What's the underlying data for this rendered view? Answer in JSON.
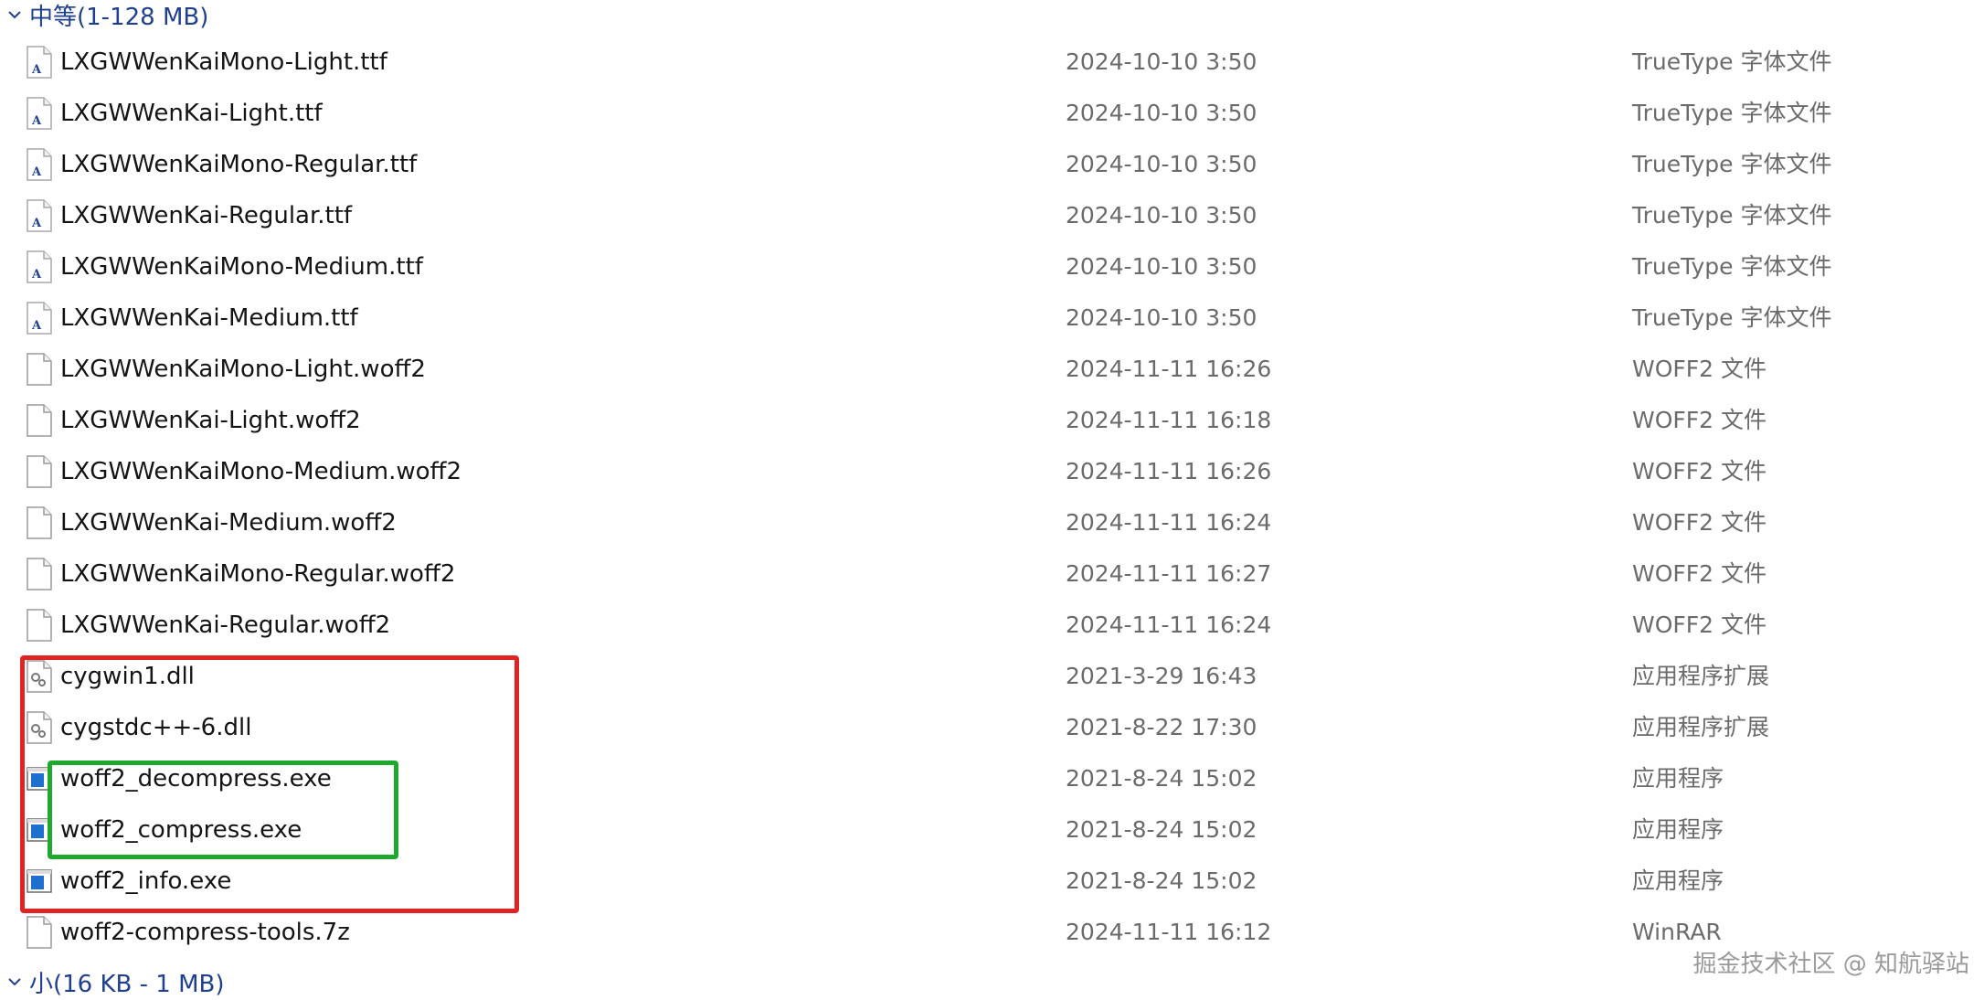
{
  "groups": {
    "medium": {
      "label": "中等(1-128 MB)"
    },
    "small": {
      "label": "小(16 KB - 1 MB)"
    }
  },
  "files": [
    {
      "name": "LXGWWenKaiMono-Light.ttf",
      "date": "2024-10-10 3:50",
      "type": "TrueType 字体文件",
      "icon": "font-file-icon"
    },
    {
      "name": "LXGWWenKai-Light.ttf",
      "date": "2024-10-10 3:50",
      "type": "TrueType 字体文件",
      "icon": "font-file-icon"
    },
    {
      "name": "LXGWWenKaiMono-Regular.ttf",
      "date": "2024-10-10 3:50",
      "type": "TrueType 字体文件",
      "icon": "font-file-icon"
    },
    {
      "name": "LXGWWenKai-Regular.ttf",
      "date": "2024-10-10 3:50",
      "type": "TrueType 字体文件",
      "icon": "font-file-icon"
    },
    {
      "name": "LXGWWenKaiMono-Medium.ttf",
      "date": "2024-10-10 3:50",
      "type": "TrueType 字体文件",
      "icon": "font-file-icon"
    },
    {
      "name": "LXGWWenKai-Medium.ttf",
      "date": "2024-10-10 3:50",
      "type": "TrueType 字体文件",
      "icon": "font-file-icon"
    },
    {
      "name": "LXGWWenKaiMono-Light.woff2",
      "date": "2024-11-11 16:26",
      "type": "WOFF2 文件",
      "icon": "blank-file-icon"
    },
    {
      "name": "LXGWWenKai-Light.woff2",
      "date": "2024-11-11 16:18",
      "type": "WOFF2 文件",
      "icon": "blank-file-icon"
    },
    {
      "name": "LXGWWenKaiMono-Medium.woff2",
      "date": "2024-11-11 16:26",
      "type": "WOFF2 文件",
      "icon": "blank-file-icon"
    },
    {
      "name": "LXGWWenKai-Medium.woff2",
      "date": "2024-11-11 16:24",
      "type": "WOFF2 文件",
      "icon": "blank-file-icon"
    },
    {
      "name": "LXGWWenKaiMono-Regular.woff2",
      "date": "2024-11-11 16:27",
      "type": "WOFF2 文件",
      "icon": "blank-file-icon"
    },
    {
      "name": "LXGWWenKai-Regular.woff2",
      "date": "2024-11-11 16:24",
      "type": "WOFF2 文件",
      "icon": "blank-file-icon"
    },
    {
      "name": "cygwin1.dll",
      "date": "2021-3-29 16:43",
      "type": "应用程序扩展",
      "icon": "dll-file-icon"
    },
    {
      "name": "cygstdc++-6.dll",
      "date": "2021-8-22 17:30",
      "type": "应用程序扩展",
      "icon": "dll-file-icon"
    },
    {
      "name": "woff2_decompress.exe",
      "date": "2021-8-24 15:02",
      "type": "应用程序",
      "icon": "exe-file-icon"
    },
    {
      "name": "woff2_compress.exe",
      "date": "2021-8-24 15:02",
      "type": "应用程序",
      "icon": "exe-file-icon"
    },
    {
      "name": "woff2_info.exe",
      "date": "2021-8-24 15:02",
      "type": "应用程序",
      "icon": "exe-file-icon"
    },
    {
      "name": "woff2-compress-tools.7z",
      "date": "2024-11-11 16:12",
      "type": "WinRAR",
      "icon": "blank-file-icon"
    }
  ],
  "watermark": "掘金技术社区 @ 知航驿站",
  "colors": {
    "group_header": "#1f3f8f",
    "highlight_red": "#e02424",
    "highlight_green": "#1fa82e",
    "exe_icon_blue": "#1f6fd1"
  }
}
